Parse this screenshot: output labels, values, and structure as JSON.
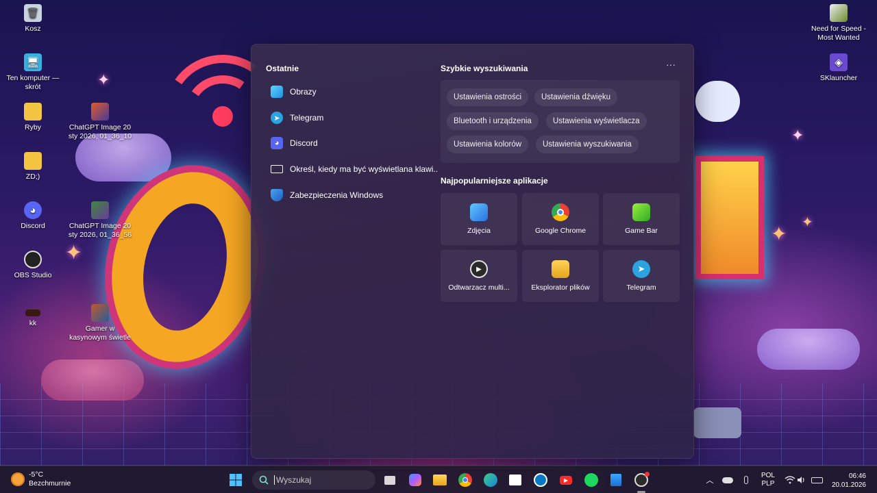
{
  "desktop": {
    "icons": [
      {
        "label": "Kosz",
        "icon": "recycle-bin-icon"
      },
      {
        "label": "Ten komputer — skrót",
        "icon": "computer-icon"
      },
      {
        "label": "Ryby",
        "icon": "folder-icon"
      },
      {
        "label": "ChatGPT Image 20 sty 2026, 01_36_10",
        "icon": "image-icon"
      },
      {
        "label": "ZD;)",
        "icon": "folder-icon"
      },
      {
        "label": "Discord",
        "icon": "discord-icon"
      },
      {
        "label": "ChatGPT Image 20 sty 2026, 01_36_56",
        "icon": "image-icon"
      },
      {
        "label": "OBS Studio",
        "icon": "obs-icon"
      },
      {
        "label": "kk",
        "icon": "image-icon"
      },
      {
        "label": "Gamer w kasynowym świetle",
        "icon": "image-icon"
      },
      {
        "label": "Need for Speed - Most Wanted",
        "icon": "game-icon"
      },
      {
        "label": "SKlauncher",
        "icon": "launcher-icon"
      }
    ]
  },
  "start": {
    "recent_title": "Ostatnie",
    "recent": [
      {
        "label": "Obrazy",
        "icon": "pictures-icon",
        "color": "#35b6f0"
      },
      {
        "label": "Telegram",
        "icon": "telegram-icon",
        "color": "#2aa3e0"
      },
      {
        "label": "Discord",
        "icon": "discord-icon",
        "color": "#5865f2"
      },
      {
        "label": "Określ, kiedy ma być wyświetlana klawi...",
        "icon": "keyboard-icon",
        "color": "#ffffff"
      },
      {
        "label": "Zabezpieczenia Windows",
        "icon": "shield-icon",
        "color": "#2f7fd8"
      }
    ],
    "quick_title": "Szybkie wyszukiwania",
    "quick": [
      "Ustawienia ostrości",
      "Ustawienia dźwięku",
      "Bluetooth i urządzenia",
      "Ustawienia wyświetlacza",
      "Ustawienia kolorów",
      "Ustawienia wyszukiwania"
    ],
    "more_label": "···",
    "apps_title": "Najpopularniejsze aplikacje",
    "apps": [
      {
        "label": "Zdjęcia",
        "icon": "photos-icon"
      },
      {
        "label": "Google Chrome",
        "icon": "chrome-icon"
      },
      {
        "label": "Game Bar",
        "icon": "gamebar-icon"
      },
      {
        "label": "Odtwarzacz multi...",
        "icon": "media-player-icon"
      },
      {
        "label": "Eksplorator plików",
        "icon": "file-explorer-icon"
      },
      {
        "label": "Telegram",
        "icon": "telegram-icon"
      }
    ]
  },
  "taskbar": {
    "weather_temp": "-5°C",
    "weather_desc": "Bezchmurnie",
    "search_placeholder": "Wyszukaj",
    "lang_top": "POL",
    "lang_bottom": "PLP",
    "time": "06:46",
    "date": "20.01.2026"
  }
}
